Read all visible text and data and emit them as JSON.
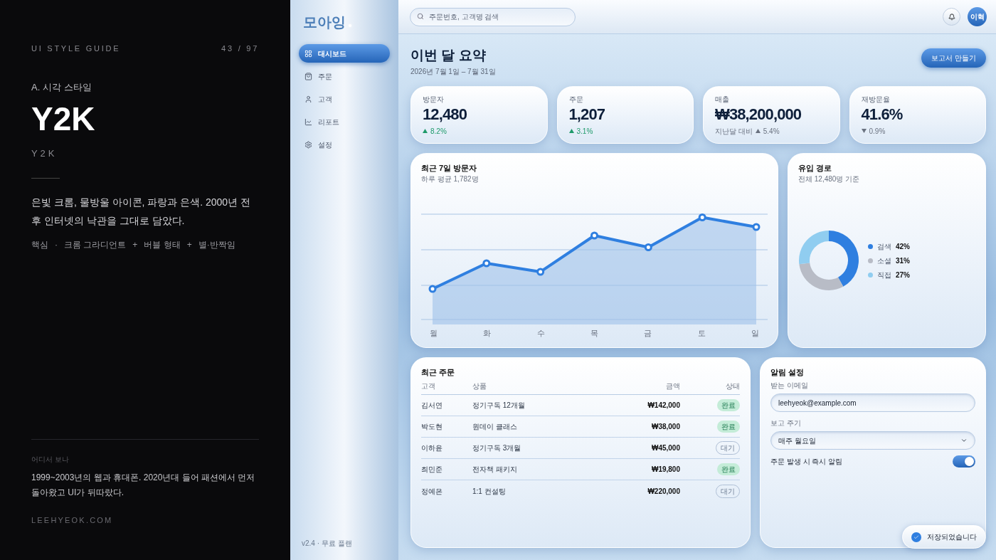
{
  "guide": {
    "header": "UI STYLE GUIDE",
    "page": "43 / 97",
    "section": "A. 시각 스타일",
    "title": "Y2K",
    "subtitle": "Y2K",
    "description": "은빛 크롬, 물방울 아이콘, 파랑과 은색. 2000년 전후 인터넷의 낙관을 그대로 담았다.",
    "core": [
      "핵심",
      "·",
      "크롬 그라디언트",
      "+",
      "버블 형태",
      "+",
      "별·반짝임"
    ],
    "origin_label": "어디서 보나",
    "origin_text": "1999~2003년의 웹과 휴대폰. 2020년대 들어 패션에서 먼저 돌아왔고 UI가 뒤따랐다.",
    "site": "LEEHYEOK.COM"
  },
  "sidebar": {
    "logo": "모아잉",
    "items": [
      {
        "label": "대시보드",
        "selected": true
      },
      {
        "label": "주문",
        "selected": false
      },
      {
        "label": "고객",
        "selected": false
      },
      {
        "label": "리포트",
        "selected": false
      },
      {
        "label": "설정",
        "selected": false
      }
    ],
    "footer": "v2.4 · 무료 플랜"
  },
  "topbar": {
    "search": {
      "placeholder": "주문번호, 고객명 검색"
    },
    "avatar": "이혁"
  },
  "heading": {
    "title": "이번 달 요약",
    "date": "2026년 7월 1일 – 7월 31일",
    "button": "보고서 만들기"
  },
  "stats": [
    {
      "label": "방문자",
      "value": "12,480",
      "delta": "8.2%",
      "kind": "up"
    },
    {
      "label": "주문",
      "value": "1,207",
      "delta": "3.1%",
      "kind": "up"
    },
    {
      "label": "매출",
      "value": "₩38,200,000",
      "prefix": "지난달 대비",
      "delta": "5.4%",
      "kind": "up"
    },
    {
      "label": "재방문율",
      "value": "41.6%",
      "delta": "0.9%",
      "kind": "down"
    }
  ],
  "visitors": {
    "title": "최근 7일 방문자",
    "subtitle": "하루 평균 1,782명",
    "days": [
      "월",
      "화",
      "수",
      "목",
      "금",
      "토",
      "일"
    ]
  },
  "sources": {
    "title": "유입 경로",
    "subtitle": "전체 12,480명 기준",
    "chart_data": {
      "type": "donut",
      "categories": [
        "검색",
        "소셜",
        "직접"
      ],
      "values": [
        42,
        31,
        27
      ]
    },
    "legend": [
      {
        "value": "42%",
        "color": "#2f7fe0"
      },
      {
        "value": "31%",
        "color": "#b8bcc6"
      },
      {
        "value": "27%",
        "color": "#90cdf0"
      }
    ]
  },
  "orders": {
    "title": "최근 주문",
    "columns": [
      "고객",
      "상품",
      "금액",
      "상태"
    ],
    "rows": [
      {
        "customer": "김서연",
        "product": "정기구독 12개월",
        "amount": "₩142,000",
        "status": "완료",
        "kind": "done"
      },
      {
        "customer": "박도현",
        "product": "원데이 클래스",
        "amount": "₩38,000",
        "status": "완료",
        "kind": "done"
      },
      {
        "customer": "이하윤",
        "product": "정기구독 3개월",
        "amount": "₩45,000",
        "status": "대기",
        "kind": "waiting"
      },
      {
        "customer": "최민준",
        "product": "전자책 패키지",
        "amount": "₩19,800",
        "status": "완료",
        "kind": "done"
      },
      {
        "customer": "정예은",
        "product": "1:1 컨설팅",
        "amount": "₩220,000",
        "status": "대기",
        "kind": "waiting"
      }
    ]
  },
  "alerts": {
    "title": "알림 설정",
    "email_label": "받는 이메일",
    "email": "leehyeok@example.com",
    "period_label": "보고 주기",
    "period": "매주 월요일",
    "toggle_label": "주문 발생 시 즉시 알림",
    "toggle_on": true
  },
  "toast": "저장되었습니다"
}
